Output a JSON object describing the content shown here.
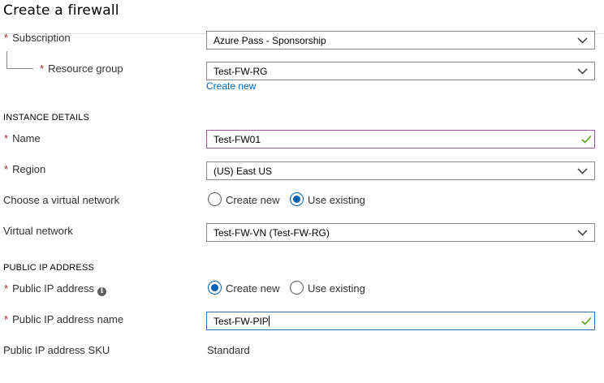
{
  "page": {
    "title": "Create a firewall"
  },
  "project": {
    "subscription": {
      "label": "Subscription",
      "value": "Azure Pass - Sponsorship"
    },
    "resource_group": {
      "label": "Resource group",
      "value": "Test-FW-RG",
      "create_new_link": "Create new"
    }
  },
  "instance_details": {
    "heading": "INSTANCE DETAILS",
    "name": {
      "label": "Name",
      "value": "Test-FW01"
    },
    "region": {
      "label": "Region",
      "value": "(US) East US"
    },
    "virtual_network_choice": {
      "label": "Choose a virtual network",
      "options": [
        {
          "label": "Create new",
          "selected": false
        },
        {
          "label": "Use existing",
          "selected": true
        }
      ]
    },
    "virtual_network": {
      "label": "Virtual network",
      "value": "Test-FW-VN (Test-FW-RG)"
    }
  },
  "public_ip": {
    "heading": "PUBLIC IP ADDRESS",
    "address": {
      "label": "Public IP address",
      "info_icon": "info-icon",
      "options": [
        {
          "label": "Create new",
          "selected": true
        },
        {
          "label": "Use existing",
          "selected": false
        }
      ]
    },
    "address_name": {
      "label": "Public IP address name",
      "value": "Test-FW-PIP"
    },
    "sku": {
      "label": "Public IP address SKU",
      "value": "Standard"
    }
  },
  "colors": {
    "required": "#a4262c",
    "accent": "#0063b1",
    "valid": "#57a300",
    "link": "#0064b4"
  }
}
